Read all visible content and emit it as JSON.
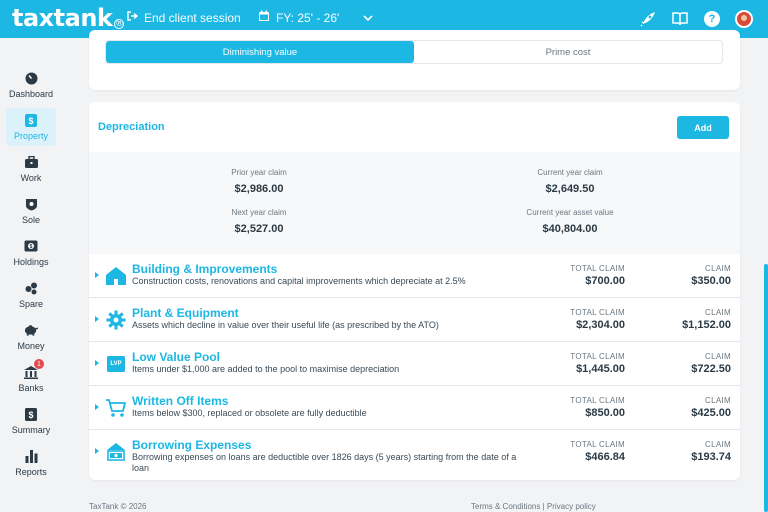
{
  "header": {
    "logo_text": "taxtank",
    "logo_mark": "®",
    "end_session_label": "End client session",
    "fy_label": "FY: 25' - 26'",
    "icons": [
      "rocket-icon",
      "book-icon",
      "help-icon",
      "avatar"
    ]
  },
  "sidebar": {
    "items": [
      {
        "label": "Dashboard",
        "icon": "dashboard-icon",
        "active": false
      },
      {
        "label": "Property",
        "icon": "property-icon",
        "active": true
      },
      {
        "label": "Work",
        "icon": "work-icon",
        "active": false
      },
      {
        "label": "Sole",
        "icon": "sole-icon",
        "active": false
      },
      {
        "label": "Holdings",
        "icon": "holdings-icon",
        "active": false
      },
      {
        "label": "Spare",
        "icon": "spare-icon",
        "active": false
      },
      {
        "label": "Money",
        "icon": "money-icon",
        "active": false
      },
      {
        "label": "Banks",
        "icon": "banks-icon",
        "active": false,
        "badge": "1"
      },
      {
        "label": "Summary",
        "icon": "summary-icon",
        "active": false
      },
      {
        "label": "Reports",
        "icon": "reports-icon",
        "active": false
      }
    ]
  },
  "method_toggle": {
    "options": [
      "Diminishing value",
      "Prime cost"
    ],
    "selected": "Diminishing value"
  },
  "depreciation": {
    "title": "Depreciation",
    "add_label": "Add",
    "summary": {
      "prior_year_label": "Prior year claim",
      "prior_year_value": "$2,986.00",
      "current_year_label": "Current year claim",
      "current_year_value": "$2,649.50",
      "next_year_label": "Next year claim",
      "next_year_value": "$2,527.00",
      "asset_value_label": "Current year asset value",
      "asset_value_value": "$40,804.00"
    },
    "total_claim_label": "TOTAL CLAIM",
    "claim_label": "CLAIM",
    "rows": [
      {
        "title": "Building & Improvements",
        "desc": "Construction costs, renovations and capital improvements which depreciate at 2.5%",
        "total": "$700.00",
        "claim": "$350.00",
        "icon": "building-icon"
      },
      {
        "title": "Plant & Equipment",
        "desc": "Assets which decline in value over their useful life (as prescribed by the ATO)",
        "total": "$2,304.00",
        "claim": "$1,152.00",
        "icon": "gear-icon"
      },
      {
        "title": "Low Value Pool",
        "desc": "Items under $1,000 are added to the pool to maximise depreciation",
        "total": "$1,445.00",
        "claim": "$722.50",
        "icon": "lvp-icon",
        "icon_text": "LVP"
      },
      {
        "title": "Written Off Items",
        "desc": "Items below $300, replaced or obsolete are fully deductible",
        "total": "$850.00",
        "claim": "$425.00",
        "icon": "cart-icon"
      },
      {
        "title": "Borrowing Expenses",
        "desc": "Borrowing expenses on loans are deductible over 1826 days (5 years) starting from the date of a loan",
        "total": "$466.84",
        "claim": "$193.74",
        "icon": "borrowing-icon"
      }
    ]
  },
  "footer": {
    "copyright": "TaxTank © 2026",
    "links": "Terms & Conditions | Privacy policy"
  },
  "colors": {
    "accent": "#1cb7e3",
    "background": "#f2f3f5",
    "text": "#2b3a45"
  }
}
